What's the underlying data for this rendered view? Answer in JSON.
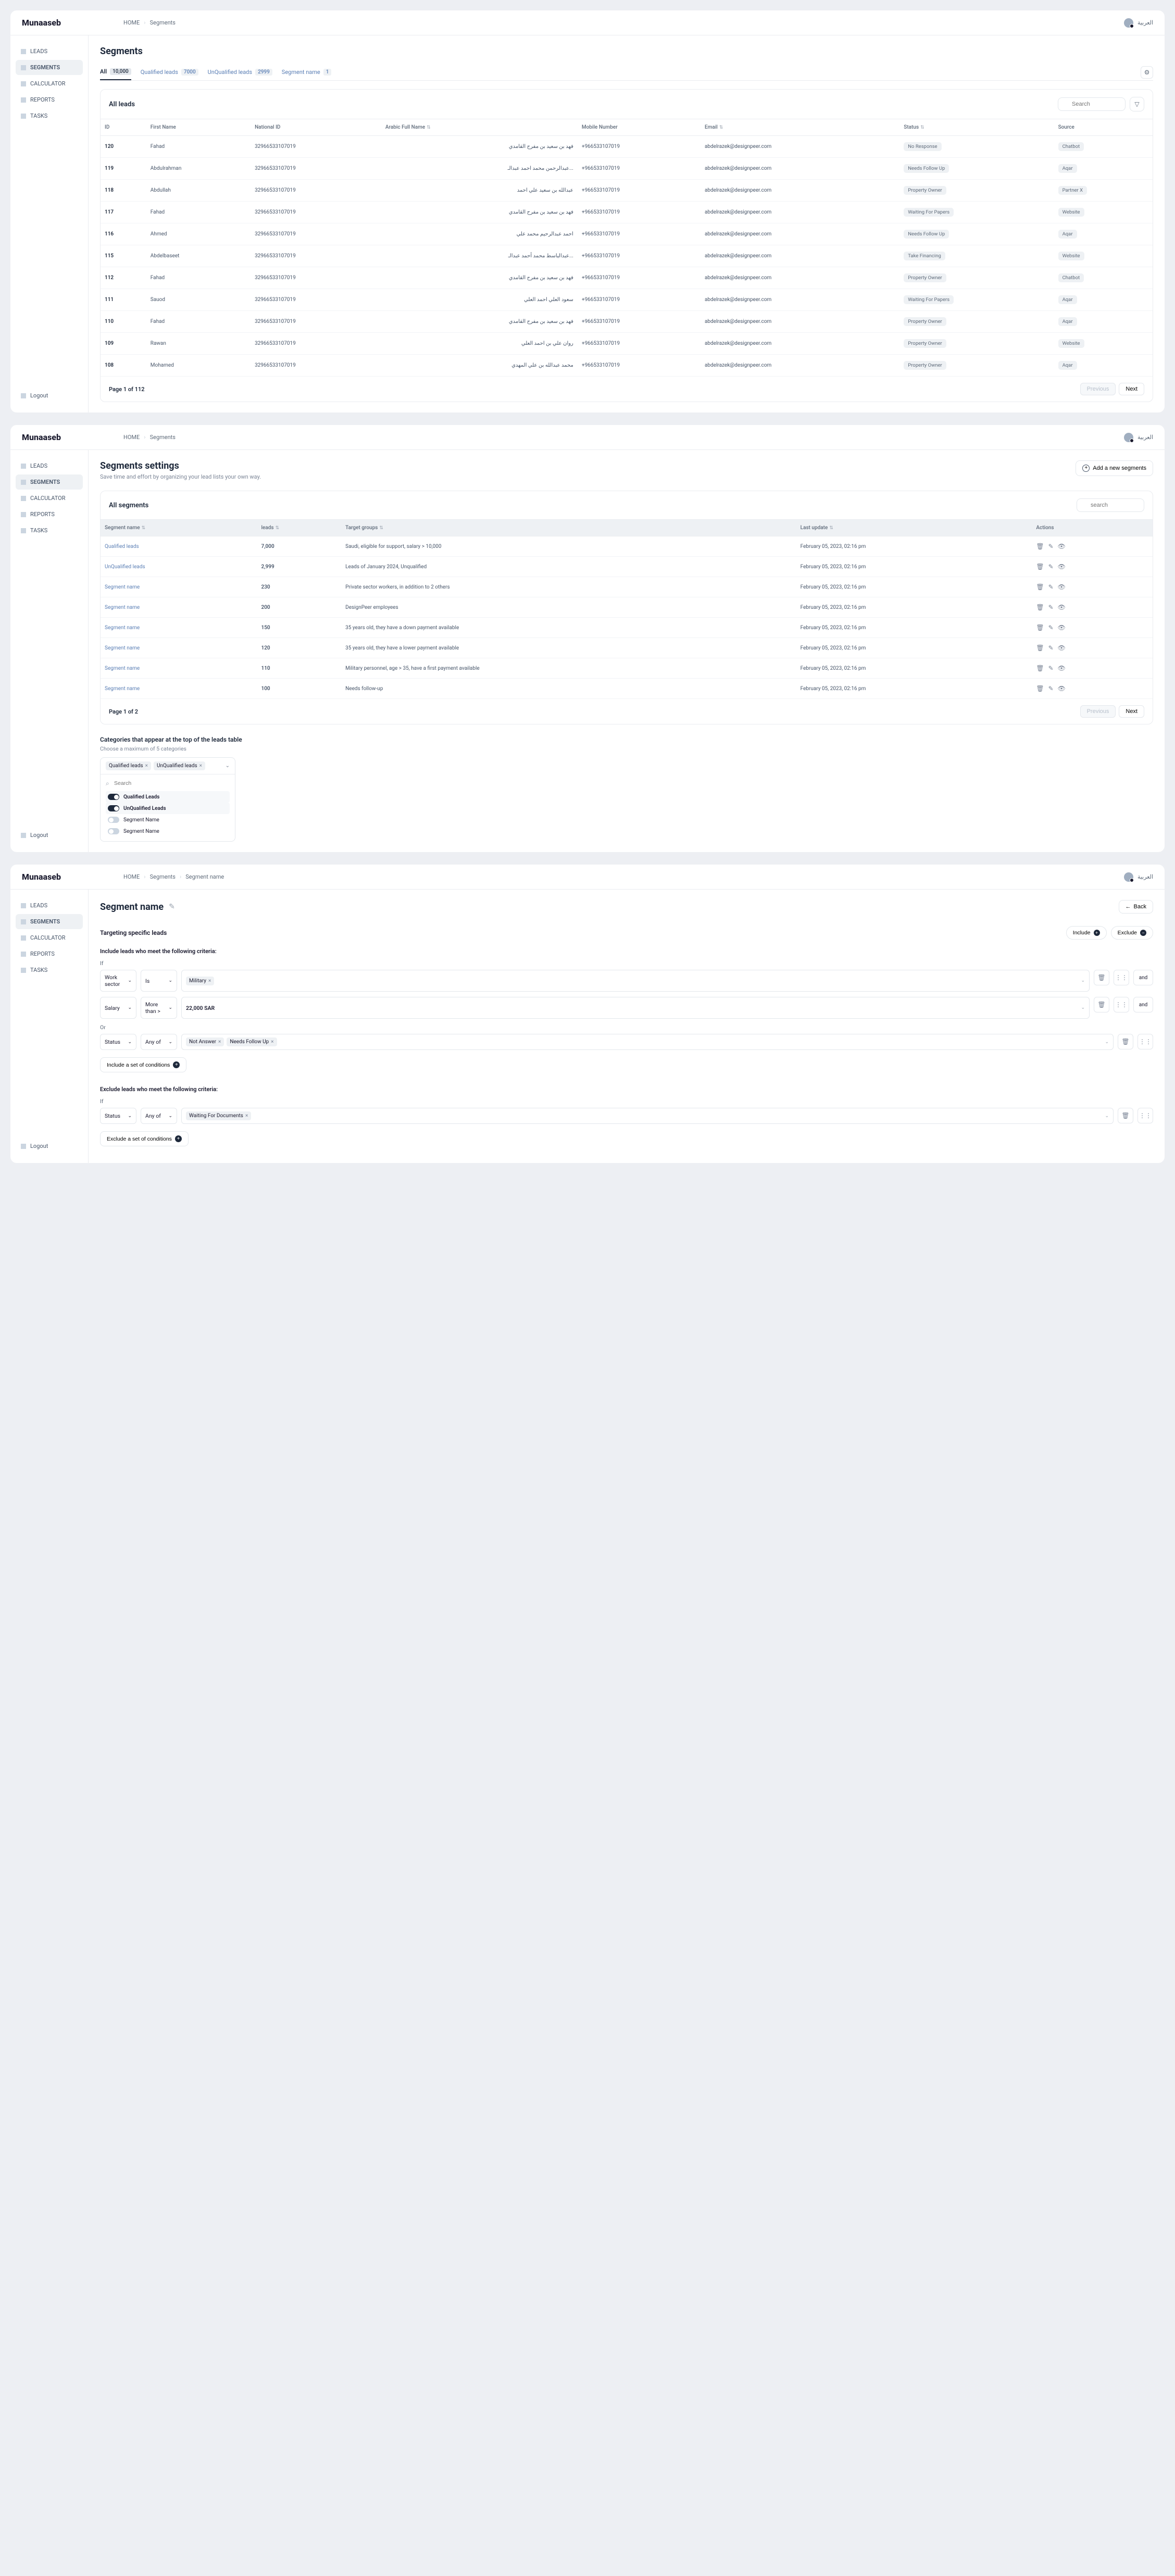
{
  "brand": "Munaaseb",
  "lang_label": "العربية",
  "nav": [
    "LEADS",
    "SEGMENTS",
    "CALCULATOR",
    "REPORTS",
    "TASKS"
  ],
  "logout": "Logout",
  "screen1": {
    "crumbs": [
      "HOME",
      "Segments"
    ],
    "title": "Segments",
    "tabs": [
      {
        "label": "All",
        "count": "10,000"
      },
      {
        "label": "Qualified leads",
        "count": "7000"
      },
      {
        "label": "UnQualified leads",
        "count": "2999"
      },
      {
        "label": "Segment name",
        "count": "1"
      }
    ],
    "panel_title": "All leads",
    "search_ph": "Search",
    "cols": [
      "ID",
      "First Name",
      "National ID",
      "Arabic Full Name",
      "Mobile Number",
      "Email",
      "Status",
      "Source"
    ],
    "rows": [
      {
        "id": "120",
        "fn": "Fahad",
        "nid": "32966533107019",
        "ar": "فهد بن سعيد بن مفرح القامدي",
        "mob": "+966533107019",
        "em": "abdelrazek@designpeer.com",
        "st": "No Response",
        "src": "Chatbot"
      },
      {
        "id": "119",
        "fn": "Abdulrahman",
        "nid": "32966533107019",
        "ar": "...عبدالرحمن محمد احمد عبدالـ",
        "mob": "+966533107019",
        "em": "abdelrazek@designpeer.com",
        "st": "Needs Follow Up",
        "src": "Aqar"
      },
      {
        "id": "118",
        "fn": "Abdullah",
        "nid": "32966533107019",
        "ar": "عبدالله بن سعيد علي احمد",
        "mob": "+966533107019",
        "em": "abdelrazek@designpeer.com",
        "st": "Property Owner",
        "src": "Partner X"
      },
      {
        "id": "117",
        "fn": "Fahad",
        "nid": "32966533107019",
        "ar": "فهد بن سعيد بن مفرح القامدي",
        "mob": "+966533107019",
        "em": "abdelrazek@designpeer.com",
        "st": "Waiting For Papers",
        "src": "Website"
      },
      {
        "id": "116",
        "fn": "Ahmed",
        "nid": "32966533107019",
        "ar": "احمد عبدالرحيم محمد علي",
        "mob": "+966533107019",
        "em": "abdelrazek@designpeer.com",
        "st": "Needs Follow Up",
        "src": "Aqar"
      },
      {
        "id": "115",
        "fn": "Abdelbaseet",
        "nid": "32966533107019",
        "ar": "...عبدالباسط محمد أحمد عبدالـ",
        "mob": "+966533107019",
        "em": "abdelrazek@designpeer.com",
        "st": "Take Financing",
        "src": "Website"
      },
      {
        "id": "112",
        "fn": "Fahad",
        "nid": "32966533107019",
        "ar": "فهد بن سعيد بن مفرح القامدي",
        "mob": "+966533107019",
        "em": "abdelrazek@designpeer.com",
        "st": "Property Owner",
        "src": "Chatbot"
      },
      {
        "id": "111",
        "fn": "Sauod",
        "nid": "32966533107019",
        "ar": "سعود العلي احمد العلي",
        "mob": "+966533107019",
        "em": "abdelrazek@designpeer.com",
        "st": "Waiting For Papers",
        "src": "Aqar"
      },
      {
        "id": "110",
        "fn": "Fahad",
        "nid": "32966533107019",
        "ar": "فهد بن سعيد بن مفرح القامدي",
        "mob": "+966533107019",
        "em": "abdelrazek@designpeer.com",
        "st": "Property Owner",
        "src": "Aqar"
      },
      {
        "id": "109",
        "fn": "Rawan",
        "nid": "32966533107019",
        "ar": "روان علي بن احمد العلي",
        "mob": "+966533107019",
        "em": "abdelrazek@designpeer.com",
        "st": "Property Owner",
        "src": "Website"
      },
      {
        "id": "108",
        "fn": "Mohamed",
        "nid": "32966533107019",
        "ar": "محمد عبدالله بن علي المهدي",
        "mob": "+966533107019",
        "em": "abdelrazek@designpeer.com",
        "st": "Property Owner",
        "src": "Aqar"
      }
    ],
    "page_info": "Page 1 of 112",
    "prev": "Previous",
    "next": "Next"
  },
  "screen2": {
    "crumbs": [
      "HOME",
      "Segments"
    ],
    "title": "Segments settings",
    "sub": "Save time and effort by organizing your lead lists your own way.",
    "add_btn": "Add a new segments",
    "panel_title": "All segments",
    "search_ph": "search",
    "cols": [
      "Segment name",
      "leads",
      "Target groups",
      "Last update",
      "Actions"
    ],
    "rows": [
      {
        "name": "Qualified leads",
        "leads": "7,000",
        "tg": "Saudi, eligible for support, salary > 10,000",
        "upd": "February 05, 2023, 02:16 pm"
      },
      {
        "name": "UnQualified leads",
        "leads": "2,999",
        "tg": "Leads of January 2024, Unqualified",
        "upd": "February 05, 2023, 02:16 pm"
      },
      {
        "name": "Segment name",
        "leads": "230",
        "tg": "Private sector workers, in addition to 2 others",
        "upd": "February 05, 2023, 02:16 pm"
      },
      {
        "name": "Segment name",
        "leads": "200",
        "tg": "DesignPeer employees",
        "upd": "February 05, 2023, 02:16 pm"
      },
      {
        "name": "Segment name",
        "leads": "150",
        "tg": "35 years old, they have a down payment available",
        "upd": "February 05, 2023, 02:16 pm"
      },
      {
        "name": "Segment name",
        "leads": "120",
        "tg": "35 years old, they have a lower payment available",
        "upd": "February 05, 2023, 02:16 pm"
      },
      {
        "name": "Segment name",
        "leads": "110",
        "tg": "Military personnel, age > 35, have a first payment available",
        "upd": "February 05, 2023, 02:16 pm"
      },
      {
        "name": "Segment name",
        "leads": "100",
        "tg": "Needs follow-up",
        "upd": "February 05, 2023, 02:16 pm"
      }
    ],
    "page_info": "Page 1 of 2",
    "prev": "Previous",
    "next": "Next",
    "cat_title": "Categories that appear at the top of the leads table",
    "cat_hint": "Choose a maximum of 5 categories",
    "ms_selected": [
      "Qualified leads",
      "UnQualified leads"
    ],
    "ms_search": "Search",
    "ms_options": [
      {
        "label": "Qualified Leads",
        "on": true
      },
      {
        "label": "UnQualified Leads",
        "on": true
      },
      {
        "label": "Segment Name",
        "on": false
      },
      {
        "label": "Segment Name",
        "on": false
      }
    ]
  },
  "screen3": {
    "crumbs": [
      "HOME",
      "Segments",
      "Segment name"
    ],
    "title": "Segment name",
    "back": "Back",
    "target_title": "Targeting specific leads",
    "include_btn": "Include",
    "exclude_btn": "Exclude",
    "include_label": "Include leads who meet the following criteria:",
    "if": "If",
    "or": "Or",
    "rules": [
      {
        "field": "Work sector",
        "op": "Is",
        "chips": [
          "Military"
        ],
        "and": true
      },
      {
        "field": "Salary",
        "op": "More than >",
        "chips": [
          "22,000 SAR"
        ],
        "plain": true,
        "and": true
      }
    ],
    "or_rules": [
      {
        "field": "Status",
        "op": "Any of",
        "chips": [
          "Not Answer",
          "Needs Follow Up"
        ]
      }
    ],
    "include_set": "Include a set of conditions",
    "exclude_label": "Exclude leads who meet the following criteria:",
    "ex_rules": [
      {
        "field": "Status",
        "op": "Any of",
        "chips": [
          "Waiting For Documents"
        ]
      }
    ],
    "exclude_set": "Exclude a set of conditions"
  }
}
